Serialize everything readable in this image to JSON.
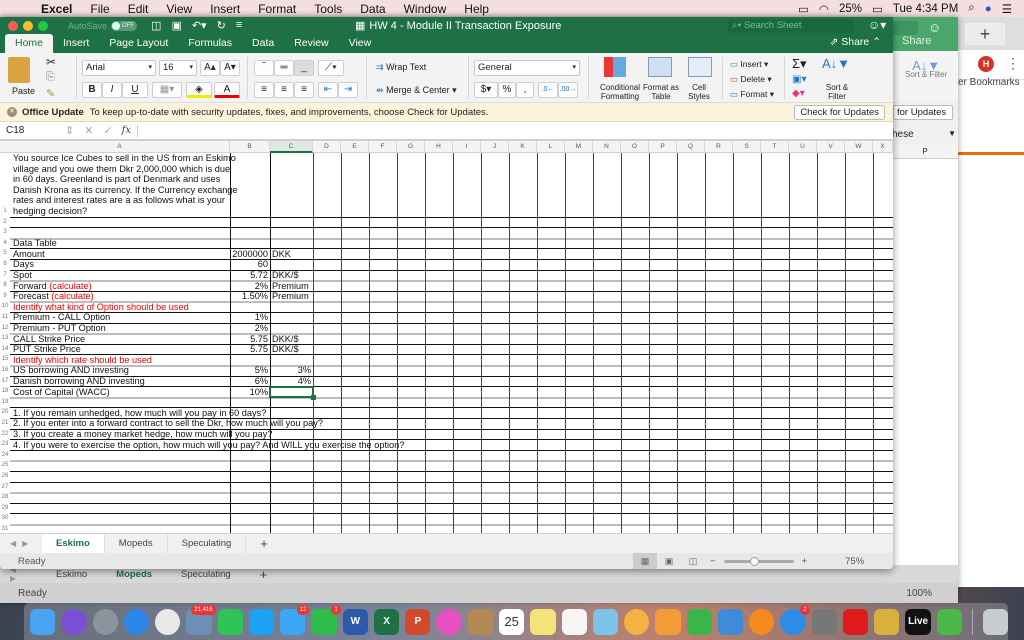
{
  "menubar": {
    "app": "Excel",
    "items": [
      "File",
      "Edit",
      "View",
      "Insert",
      "Format",
      "Tools",
      "Data",
      "Window",
      "Help"
    ],
    "battery": "25%",
    "clock": "Tue 4:34 PM"
  },
  "window": {
    "autosave_label": "AutoSave",
    "autosave_state": "OFF",
    "title": "HW 4 - Module II Transaction Exposure",
    "search_placeholder": "Search Sheet",
    "share_label": "Share",
    "ribbon_tabs": [
      "Home",
      "Insert",
      "Page Layout",
      "Formulas",
      "Data",
      "Review",
      "View"
    ],
    "active_tab": "Home"
  },
  "ribbon": {
    "paste": "Paste",
    "font_name": "Arial",
    "font_size": "16",
    "bold": "B",
    "italic": "I",
    "underline": "U",
    "wrap_text": "Wrap Text",
    "merge_center": "Merge & Center",
    "number_format": "General",
    "currency": "$",
    "percent": "%",
    "comma": ",",
    "conditional_formatting": "Conditional Formatting",
    "format_as_table": "Format as Table",
    "cell_styles": "Cell Styles",
    "insert": "Insert",
    "delete": "Delete",
    "format": "Format",
    "sort_filter": "Sort & Filter"
  },
  "notice": {
    "title": "Office Update",
    "message": "To keep up-to-date with security updates, fixes, and improvements, choose Check for Updates.",
    "button": "Check for Updates"
  },
  "formula_bar": {
    "name_box": "C18",
    "fx": "fx",
    "value": ""
  },
  "columns": [
    "A",
    "B",
    "C",
    "D",
    "E",
    "F",
    "G",
    "H",
    "I",
    "J",
    "K",
    "L",
    "M",
    "N",
    "O",
    "P",
    "Q",
    "R",
    "S",
    "T",
    "U",
    "V",
    "W",
    "X"
  ],
  "rows": {
    "r1": "You source Ice Cubes to sell in the US from an Eskimo village and you owe them Dkr 2,000,000 which is due in 60 days. Greenland is part of Denmark and uses Danish Krona as its currency. If the Currency exchange rates and interest rates are a as follows what is your hedging decision?",
    "r1_lines": [
      "You source Ice Cubes to sell in the US from an Eskimo",
      "village and you owe them Dkr 2,000,000 which is due",
      "in 60 days. Greenland is part of Denmark and uses",
      "Danish Krona as its currency. If the Currency exchange",
      "rates and interest rates are a as follows what is your",
      "hedging decision?"
    ],
    "table": [
      {
        "row": "4",
        "a": "Data Table",
        "b": "",
        "c": ""
      },
      {
        "row": "5",
        "a": "Amount",
        "b": "2000000",
        "c": "DKK"
      },
      {
        "row": "6",
        "a": "Days",
        "b": "60",
        "c": ""
      },
      {
        "row": "7",
        "a": "Spot",
        "b": "5.72",
        "c": "DKK/$"
      },
      {
        "row": "8",
        "a": "Forward ",
        "a_red": "(calculate)",
        "b": "2%",
        "c": "Premium"
      },
      {
        "row": "9",
        "a": "Forecast ",
        "a_red": "(calculate)",
        "b": "1.50%",
        "c": "Premium"
      },
      {
        "row": "10",
        "a_red_full": "Identify what kind of Option should be used",
        "b": "",
        "c": ""
      },
      {
        "row": "11",
        "a": "Premium - CALL Option",
        "b": "1%",
        "c": ""
      },
      {
        "row": "12",
        "a": "Premium - PUT Option",
        "b": "2%",
        "c": ""
      },
      {
        "row": "13",
        "a": "CALL Strike Price",
        "b": "5.75",
        "c": "DKK/$"
      },
      {
        "row": "14",
        "a": "PUT Strike Price",
        "b": "5.75",
        "c": "DKK/$"
      },
      {
        "row": "15",
        "a_red_full": "Identify which rate should be used",
        "b": "",
        "c": ""
      },
      {
        "row": "16",
        "a": "US borrowing AND investing",
        "b": "5%",
        "c": "3%"
      },
      {
        "row": "17",
        "a": "Danish borrowing AND investing",
        "b": "6%",
        "c": "4%"
      },
      {
        "row": "18",
        "a": "Cost of Capital (WACC)",
        "b": "10%",
        "c": ""
      }
    ],
    "questions": [
      {
        "row": "20",
        "text": "1. If you remain unhedged, how much will you pay in 60 days?"
      },
      {
        "row": "21",
        "text": "2. If you enter into a forward contract to sell the Dkr, how much will you pay?"
      },
      {
        "row": "22",
        "text": "3. If you create a money market hedge, how much will you pay?"
      },
      {
        "row": "23",
        "text": "4. If you were to exercise the option, how much will you pay? And WILL you exercise the option?"
      }
    ],
    "empty_rows": [
      "2",
      "3",
      "19",
      "24",
      "25",
      "26",
      "27",
      "28",
      "29",
      "30",
      "31"
    ]
  },
  "sheet_tabs": [
    "Eskimo",
    "Mopeds",
    "Speculating"
  ],
  "active_sheet": "Eskimo",
  "add_sheet": "+",
  "status": {
    "text": "Ready",
    "zoom": "75%"
  },
  "back_window": {
    "sheet_tabs": [
      "Eskimo",
      "Mopeds",
      "Speculating"
    ],
    "active_sheet": "Mopeds",
    "status": "Ready",
    "zoom": "100%",
    "share": "Share",
    "sort_filter": "Sort & Filter",
    "update_btn": "for Updates",
    "dropdown_text": "hese",
    "col_p": "P"
  },
  "chrome": {
    "new_tab": "+",
    "avatar": "H",
    "bookmarks": "er Bookmarks"
  },
  "dock": {
    "items": [
      "Finder",
      "Siri",
      "Launchpad",
      "Safari",
      "Chrome",
      "Mail",
      "WhatsApp",
      "Twitter",
      "Messages",
      "FaceTime",
      "Word",
      "Excel",
      "PowerPoint",
      "iTunes",
      "Contacts",
      "Calendar",
      "Notes",
      "Reminders",
      "Maps",
      "Photos",
      "Pages",
      "Numbers",
      "Keynote",
      "iBooks",
      "App Store",
      "System Preferences",
      "Music",
      "Paintbrush",
      "Live",
      "BlueStacks",
      "Trash"
    ],
    "badges": {
      "Mail": "21,416",
      "Messages": "12",
      "FaceTime": "1",
      "App Store": "2"
    },
    "calendar_day": "25"
  }
}
